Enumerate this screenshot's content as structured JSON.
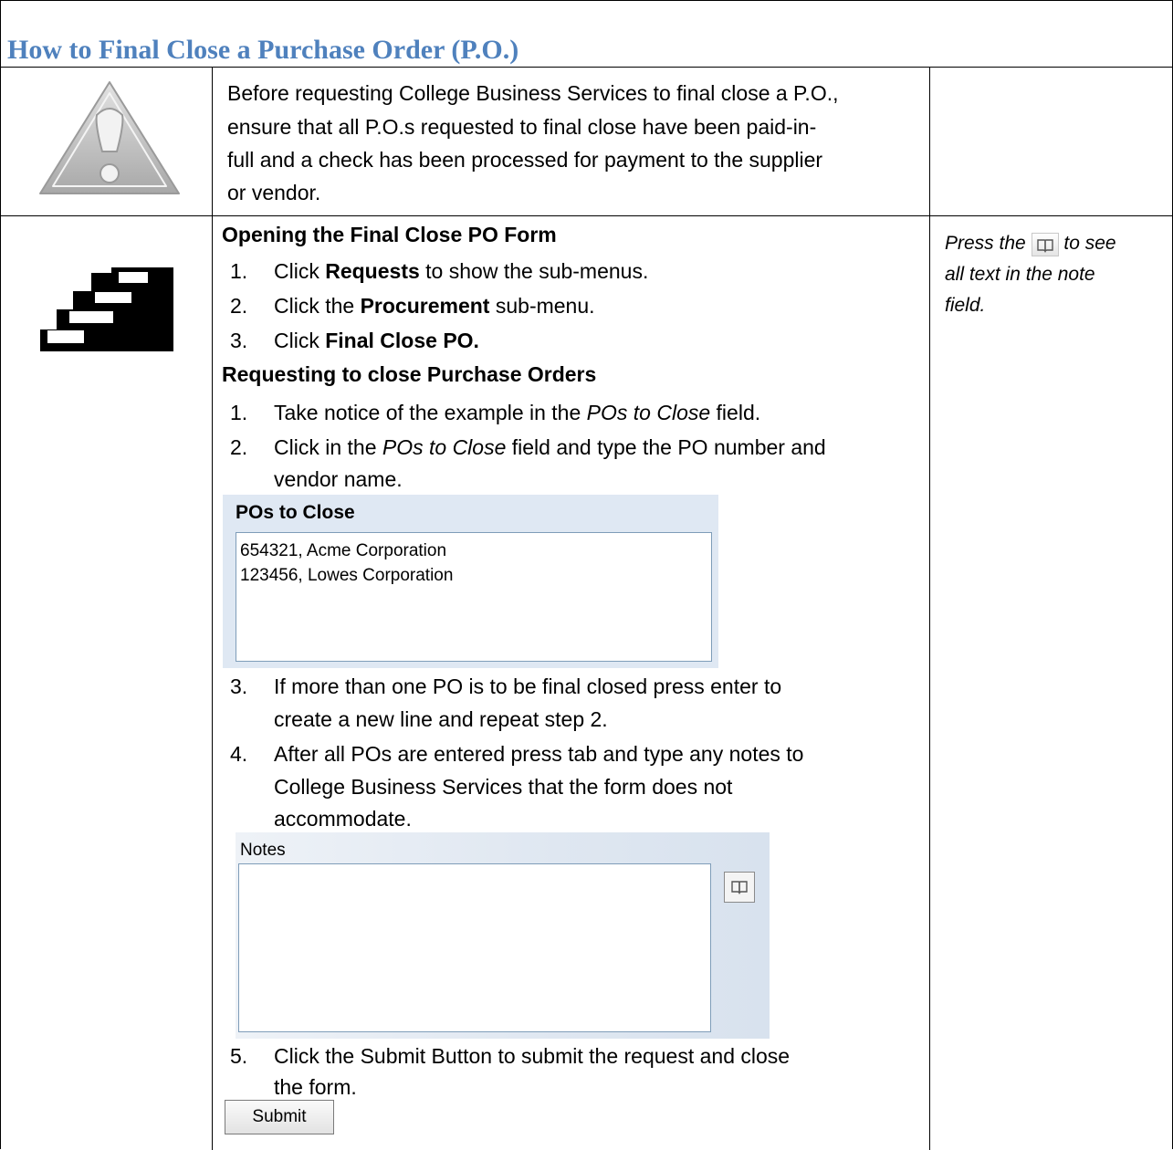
{
  "document": {
    "title": "How to Final Close a Purchase Order (P.O.)",
    "warning": {
      "icon": "warning-triangle-icon",
      "lines": [
        "Before requesting College Business Services to final close a P.O.,",
        "ensure that all P.O.s requested to final close have been paid-in-",
        "full and a check has been processed for payment to the supplier",
        "or vendor."
      ]
    },
    "steps_icon": "stairs-icon",
    "section1": {
      "heading": "Opening the Final Close PO Form",
      "steps": [
        {
          "num": "1.",
          "pre": "Click ",
          "bold": "Requests",
          "post": " to show the sub-menus."
        },
        {
          "num": "2.",
          "pre": "Click the ",
          "bold": "Procurement",
          "post": " sub-menu."
        },
        {
          "num": "3.",
          "pre": "Click ",
          "bold": "Final Close PO.",
          "post": ""
        }
      ]
    },
    "section2": {
      "heading": "Requesting to close Purchase Orders",
      "step1": {
        "num": "1.",
        "pre": "Take notice of the example in the ",
        "ital": "POs to Close",
        "post": " field."
      },
      "step2": {
        "num": "2.",
        "pre": "Click in the ",
        "ital": "POs to Close",
        "post": " field and type the PO number and",
        "line2": "vendor name."
      },
      "step3": {
        "num": "3.",
        "line1": "If more than one PO is to be final closed press enter to",
        "line2": "create a new line and repeat step 2."
      },
      "step4": {
        "num": "4.",
        "line1": "After all POs are entered press tab and type any notes to",
        "line2": "College Business Services that the form does not",
        "line3": "accommodate."
      },
      "step5": {
        "num": "5.",
        "line1": "Click the Submit Button to submit the request and close",
        "line2": "the form."
      }
    },
    "pos_field": {
      "label": "POs to Close",
      "lines": [
        "654321, Acme Corporation",
        "123456, Lowes Corporation"
      ]
    },
    "notes_field": {
      "label": "Notes",
      "value": "",
      "button_icon": "book-icon"
    },
    "submit_label": "Submit",
    "tip": {
      "pre": "Press the",
      "post": "to see",
      "line2": "all text in the note",
      "line3": "field.",
      "icon": "book-icon"
    }
  }
}
